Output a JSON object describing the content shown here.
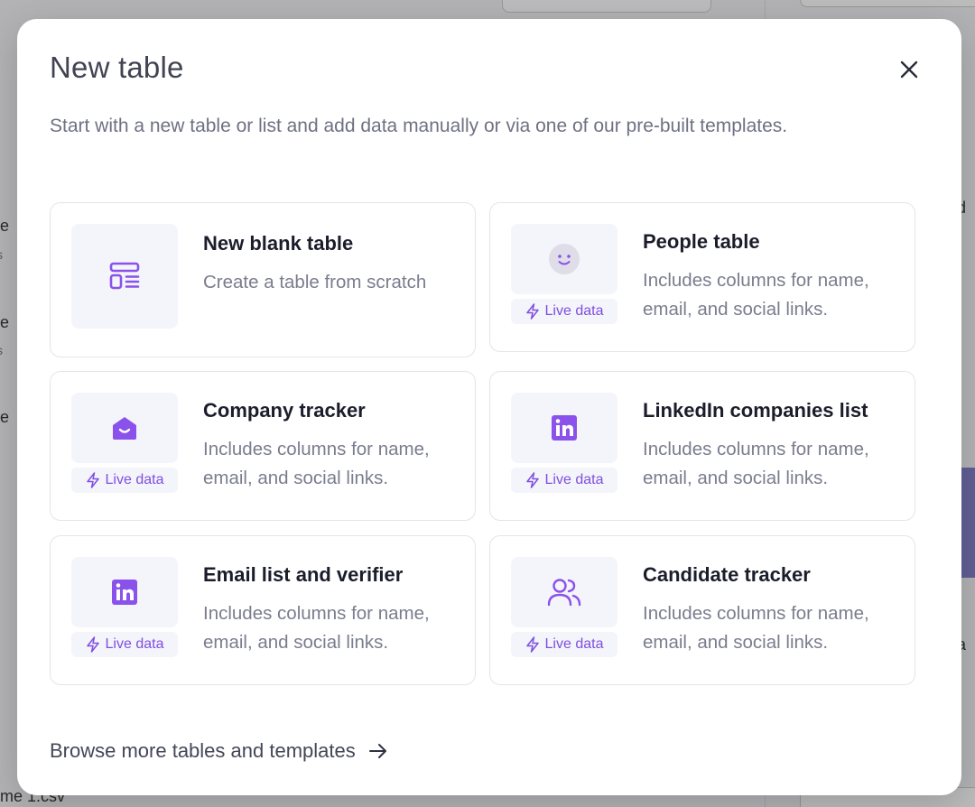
{
  "modal": {
    "title": "New table",
    "subtitle": "Start with a new table or list and add data manually or via one of our pre-built templates.",
    "browse_label": "Browse more tables and templates"
  },
  "cards": [
    {
      "title": "New blank table",
      "description": "Create a table from scratch",
      "icon": "table-layout-icon",
      "live": false
    },
    {
      "title": "People table",
      "description": "Includes columns for name, email, and social links.",
      "icon": "face-icon",
      "live": true,
      "live_label": "Live data"
    },
    {
      "title": "Company tracker",
      "description": "Includes columns for name, email, and social links.",
      "icon": "building-icon",
      "live": true,
      "live_label": "Live data"
    },
    {
      "title": "LinkedIn companies list",
      "description": "Includes columns for name, email, and social links.",
      "icon": "linkedin-icon",
      "live": true,
      "live_label": "Live data"
    },
    {
      "title": "Email list and verifier",
      "description": "Includes columns for name, email, and social links.",
      "icon": "linkedin-icon",
      "live": true,
      "live_label": "Live data"
    },
    {
      "title": "Candidate tracker",
      "description": "Includes columns for name, email, and social links.",
      "icon": "users-icon",
      "live": true,
      "live_label": "Live data"
    }
  ],
  "background": {
    "csv_fragment": "me 1.csv"
  },
  "colors": {
    "accent": "#7f4fe0",
    "title_text": "#1b1d2b",
    "muted_text": "#7a7d8e",
    "thumb_bg": "#f4f4fb"
  }
}
